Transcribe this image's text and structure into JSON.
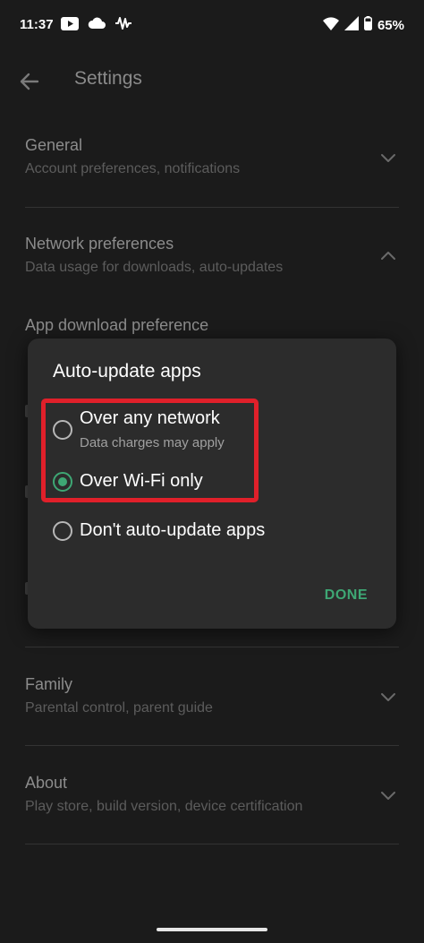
{
  "status_bar": {
    "time": "11:37",
    "left_icons": [
      "youtube-icon",
      "cloud-icon",
      "activity-wave-icon"
    ],
    "right_icons": [
      "wifi-icon",
      "signal-icon",
      "battery-icon"
    ],
    "battery": "65%"
  },
  "app_bar": {
    "title": "Settings"
  },
  "settings": {
    "general": {
      "title": "General",
      "subtitle": "Account preferences, notifications"
    },
    "network": {
      "title": "Network preferences",
      "subtitle": "Data usage for downloads, auto-updates"
    },
    "app_download": {
      "title": "App download preference"
    },
    "family": {
      "title": "Family",
      "subtitle": "Parental control, parent guide"
    },
    "about": {
      "title": "About",
      "subtitle": "Play store, build version, device certification"
    }
  },
  "dialog": {
    "title": "Auto-update apps",
    "options": [
      {
        "label": "Over any network",
        "sublabel": "Data charges may apply",
        "selected": false
      },
      {
        "label": "Over Wi-Fi only",
        "selected": true
      },
      {
        "label": "Don't auto-update apps",
        "selected": false
      }
    ],
    "done_label": "DONE",
    "accent_color": "#3ea774",
    "highlight_color": "#e0202a"
  }
}
